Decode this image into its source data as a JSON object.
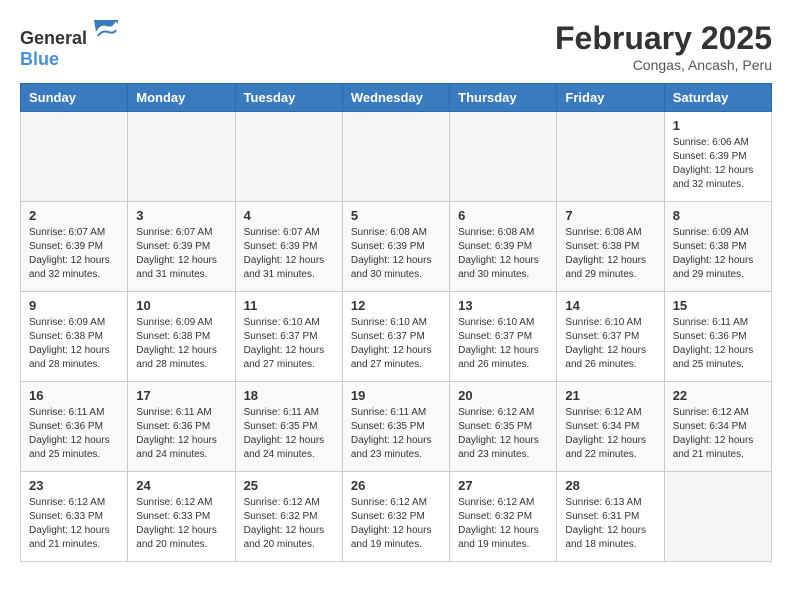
{
  "header": {
    "logo_general": "General",
    "logo_blue": "Blue",
    "title": "February 2025",
    "subtitle": "Congas, Ancash, Peru"
  },
  "days_of_week": [
    "Sunday",
    "Monday",
    "Tuesday",
    "Wednesday",
    "Thursday",
    "Friday",
    "Saturday"
  ],
  "weeks": [
    [
      {
        "day": "",
        "info": ""
      },
      {
        "day": "",
        "info": ""
      },
      {
        "day": "",
        "info": ""
      },
      {
        "day": "",
        "info": ""
      },
      {
        "day": "",
        "info": ""
      },
      {
        "day": "",
        "info": ""
      },
      {
        "day": "1",
        "info": "Sunrise: 6:06 AM\nSunset: 6:39 PM\nDaylight: 12 hours and 32 minutes."
      }
    ],
    [
      {
        "day": "2",
        "info": "Sunrise: 6:07 AM\nSunset: 6:39 PM\nDaylight: 12 hours and 32 minutes."
      },
      {
        "day": "3",
        "info": "Sunrise: 6:07 AM\nSunset: 6:39 PM\nDaylight: 12 hours and 31 minutes."
      },
      {
        "day": "4",
        "info": "Sunrise: 6:07 AM\nSunset: 6:39 PM\nDaylight: 12 hours and 31 minutes."
      },
      {
        "day": "5",
        "info": "Sunrise: 6:08 AM\nSunset: 6:39 PM\nDaylight: 12 hours and 30 minutes."
      },
      {
        "day": "6",
        "info": "Sunrise: 6:08 AM\nSunset: 6:39 PM\nDaylight: 12 hours and 30 minutes."
      },
      {
        "day": "7",
        "info": "Sunrise: 6:08 AM\nSunset: 6:38 PM\nDaylight: 12 hours and 29 minutes."
      },
      {
        "day": "8",
        "info": "Sunrise: 6:09 AM\nSunset: 6:38 PM\nDaylight: 12 hours and 29 minutes."
      }
    ],
    [
      {
        "day": "9",
        "info": "Sunrise: 6:09 AM\nSunset: 6:38 PM\nDaylight: 12 hours and 28 minutes."
      },
      {
        "day": "10",
        "info": "Sunrise: 6:09 AM\nSunset: 6:38 PM\nDaylight: 12 hours and 28 minutes."
      },
      {
        "day": "11",
        "info": "Sunrise: 6:10 AM\nSunset: 6:37 PM\nDaylight: 12 hours and 27 minutes."
      },
      {
        "day": "12",
        "info": "Sunrise: 6:10 AM\nSunset: 6:37 PM\nDaylight: 12 hours and 27 minutes."
      },
      {
        "day": "13",
        "info": "Sunrise: 6:10 AM\nSunset: 6:37 PM\nDaylight: 12 hours and 26 minutes."
      },
      {
        "day": "14",
        "info": "Sunrise: 6:10 AM\nSunset: 6:37 PM\nDaylight: 12 hours and 26 minutes."
      },
      {
        "day": "15",
        "info": "Sunrise: 6:11 AM\nSunset: 6:36 PM\nDaylight: 12 hours and 25 minutes."
      }
    ],
    [
      {
        "day": "16",
        "info": "Sunrise: 6:11 AM\nSunset: 6:36 PM\nDaylight: 12 hours and 25 minutes."
      },
      {
        "day": "17",
        "info": "Sunrise: 6:11 AM\nSunset: 6:36 PM\nDaylight: 12 hours and 24 minutes."
      },
      {
        "day": "18",
        "info": "Sunrise: 6:11 AM\nSunset: 6:35 PM\nDaylight: 12 hours and 24 minutes."
      },
      {
        "day": "19",
        "info": "Sunrise: 6:11 AM\nSunset: 6:35 PM\nDaylight: 12 hours and 23 minutes."
      },
      {
        "day": "20",
        "info": "Sunrise: 6:12 AM\nSunset: 6:35 PM\nDaylight: 12 hours and 23 minutes."
      },
      {
        "day": "21",
        "info": "Sunrise: 6:12 AM\nSunset: 6:34 PM\nDaylight: 12 hours and 22 minutes."
      },
      {
        "day": "22",
        "info": "Sunrise: 6:12 AM\nSunset: 6:34 PM\nDaylight: 12 hours and 21 minutes."
      }
    ],
    [
      {
        "day": "23",
        "info": "Sunrise: 6:12 AM\nSunset: 6:33 PM\nDaylight: 12 hours and 21 minutes."
      },
      {
        "day": "24",
        "info": "Sunrise: 6:12 AM\nSunset: 6:33 PM\nDaylight: 12 hours and 20 minutes."
      },
      {
        "day": "25",
        "info": "Sunrise: 6:12 AM\nSunset: 6:32 PM\nDaylight: 12 hours and 20 minutes."
      },
      {
        "day": "26",
        "info": "Sunrise: 6:12 AM\nSunset: 6:32 PM\nDaylight: 12 hours and 19 minutes."
      },
      {
        "day": "27",
        "info": "Sunrise: 6:12 AM\nSunset: 6:32 PM\nDaylight: 12 hours and 19 minutes."
      },
      {
        "day": "28",
        "info": "Sunrise: 6:13 AM\nSunset: 6:31 PM\nDaylight: 12 hours and 18 minutes."
      },
      {
        "day": "",
        "info": ""
      }
    ]
  ]
}
